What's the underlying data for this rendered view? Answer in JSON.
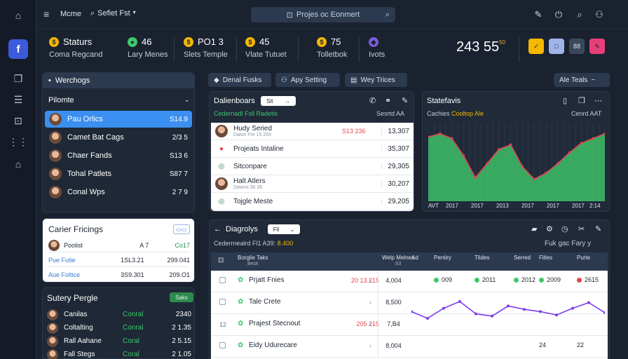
{
  "topbar": {
    "menu": "Mcme",
    "breadcrumb": "Sefiet Fst",
    "search": "Projes oc Eonmert"
  },
  "stats": [
    {
      "value": "Staturs",
      "label": "Coma Regcand",
      "color": "#f5b700",
      "glyph": "$"
    },
    {
      "value": "46",
      "label": "Lary Menes",
      "color": "#3fc66b",
      "glyph": "●"
    },
    {
      "value": "PO1 3",
      "label": "Slets Temple",
      "color": "#f5b700",
      "glyph": "$"
    },
    {
      "value": "45",
      "label": "Vlate Tutuet",
      "color": "#f5b700",
      "glyph": "$"
    },
    {
      "value": "75",
      "label": "Tolletbok",
      "color": "#f5b700",
      "glyph": "$"
    },
    {
      "value": "",
      "label": "Ivots",
      "color": "#7c5cd6",
      "glyph": "◆"
    }
  ],
  "big_value": "243 55",
  "big_sup": "50",
  "actions": [
    {
      "color": "#f5b700",
      "glyph": "✓"
    },
    {
      "color": "#9fb4e8",
      "glyph": "□"
    },
    {
      "color": "#3a475c",
      "glyph": "88"
    },
    {
      "color": "#e63f7a",
      "glyph": "✎"
    }
  ],
  "left_panel": {
    "header": "Werchogs",
    "section": "Pilomte",
    "items": [
      {
        "name": "Pau Orlics",
        "value": "S14.9",
        "active": true
      },
      {
        "name": "Camet Bat Cags",
        "value": "2/3 5",
        "active": false
      },
      {
        "name": "Chaer Fands",
        "value": "S13 6",
        "active": false
      },
      {
        "name": "Tohal Patlets",
        "value": "S87 7",
        "active": false
      },
      {
        "name": "Conal Wps",
        "value": "2 7 9",
        "active": false
      }
    ]
  },
  "pricing": {
    "title": "Carier Fricings",
    "rows": [
      {
        "c1": "Poolist",
        "c2": "A 7",
        "c3": "Co17"
      },
      {
        "c1": "Pue Futie",
        "c2": "1SL3.21",
        "c3": "299.041"
      },
      {
        "c1": "Aue Foltice",
        "c2": "3S9.301",
        "c3": "209.O1"
      }
    ]
  },
  "people": {
    "title": "Sutery Pergle",
    "badge": "Saks",
    "rows": [
      {
        "name": "Canilas",
        "status": "Conral",
        "value": "2340"
      },
      {
        "name": "Coltalting",
        "status": "Conral",
        "value": "2 1.35"
      },
      {
        "name": "Rall Aahane",
        "status": "Coral",
        "value": "2 5.15"
      },
      {
        "name": "Fall Stegs",
        "status": "Coral",
        "value": "2 1.05"
      }
    ]
  },
  "buttons": [
    "Denal Fusks",
    "Apy Setting",
    "Wey Trices"
  ],
  "alt_button": "Ale Teals",
  "dashboards": {
    "title": "Dalienboars",
    "tag": "Slt",
    "sub_left": "Cedernadl Fsll Radetis",
    "sub_right": "Sesrtd AA",
    "rows": [
      {
        "name": "Hudy Seried",
        "sub": "Dalon Fre 15 200",
        "val": "S13 236",
        "val2": "13,307"
      },
      {
        "name": "Projeats Intaline",
        "sub": "",
        "val": "",
        "val2": "35,307"
      },
      {
        "name": "Sitconpare",
        "sub": "",
        "val": "",
        "val2": "29,305"
      },
      {
        "name": "Halt Atlers",
        "sub": "Dawno 30 35",
        "val": "",
        "val2": "30,207"
      },
      {
        "name": "Tojgle Meste",
        "sub": "",
        "val": "",
        "val2": "29,205"
      }
    ]
  },
  "statefavis": {
    "title": "Statefavis",
    "sub_left": "Cachies",
    "sub_accent": "Cooltop Ale",
    "sub_right": "Cenrd AAT",
    "x_labels": [
      "AVT",
      "2017",
      "2017",
      "2013",
      "2017",
      "2017",
      "2017",
      "2:14"
    ]
  },
  "chart_data": {
    "type": "area",
    "x": [
      "AVT",
      "2017",
      "2017",
      "2013",
      "2017",
      "2017",
      "2017",
      "2:14"
    ],
    "series": [
      {
        "values": [
          82,
          86,
          80,
          58,
          30,
          48,
          66,
          72,
          44,
          28,
          36,
          48,
          62,
          74,
          80,
          86
        ],
        "color": "#3fc66b"
      }
    ],
    "ylim": [
      0,
      100
    ],
    "grid": true
  },
  "diagnostics": {
    "title": "Diagrolys",
    "tag": "Fll",
    "sub": "Cederrnealrd Fl1 A39:",
    "sub_accent": "8.400",
    "sub_right": "Fuk gac Fary y",
    "columns": [
      "Borglie Taks",
      "Welp Melnes",
      "Ad",
      "Pentiry",
      "Tlides",
      "Serred",
      "Fitles",
      "Purte"
    ],
    "col_sub": [
      "Besk",
      "S3",
      "",
      "",
      "",
      "",
      "",
      ""
    ],
    "rows": [
      {
        "n": "",
        "name": "Prjatt Fnies",
        "val": "20 13.215",
        "val2": "4,004",
        "pills": [
          "009",
          "2011",
          "2012",
          "2009",
          "2615"
        ]
      },
      {
        "n": "",
        "name": "Tale Crete",
        "val": "",
        "val2": "8,500",
        "pills": []
      },
      {
        "n": "12",
        "name": "Prajest Stecnout",
        "val": "205 215",
        "val2": "7,B4",
        "pills": []
      },
      {
        "n": "",
        "name": "Eidy Udurecare",
        "val": "",
        "val2": "8,004",
        "pills": [
          "",
          "",
          "",
          "24",
          "22"
        ]
      }
    ],
    "line": [
      42,
      30,
      48,
      60,
      38,
      34,
      52,
      46,
      42,
      36,
      48,
      58,
      40
    ]
  }
}
